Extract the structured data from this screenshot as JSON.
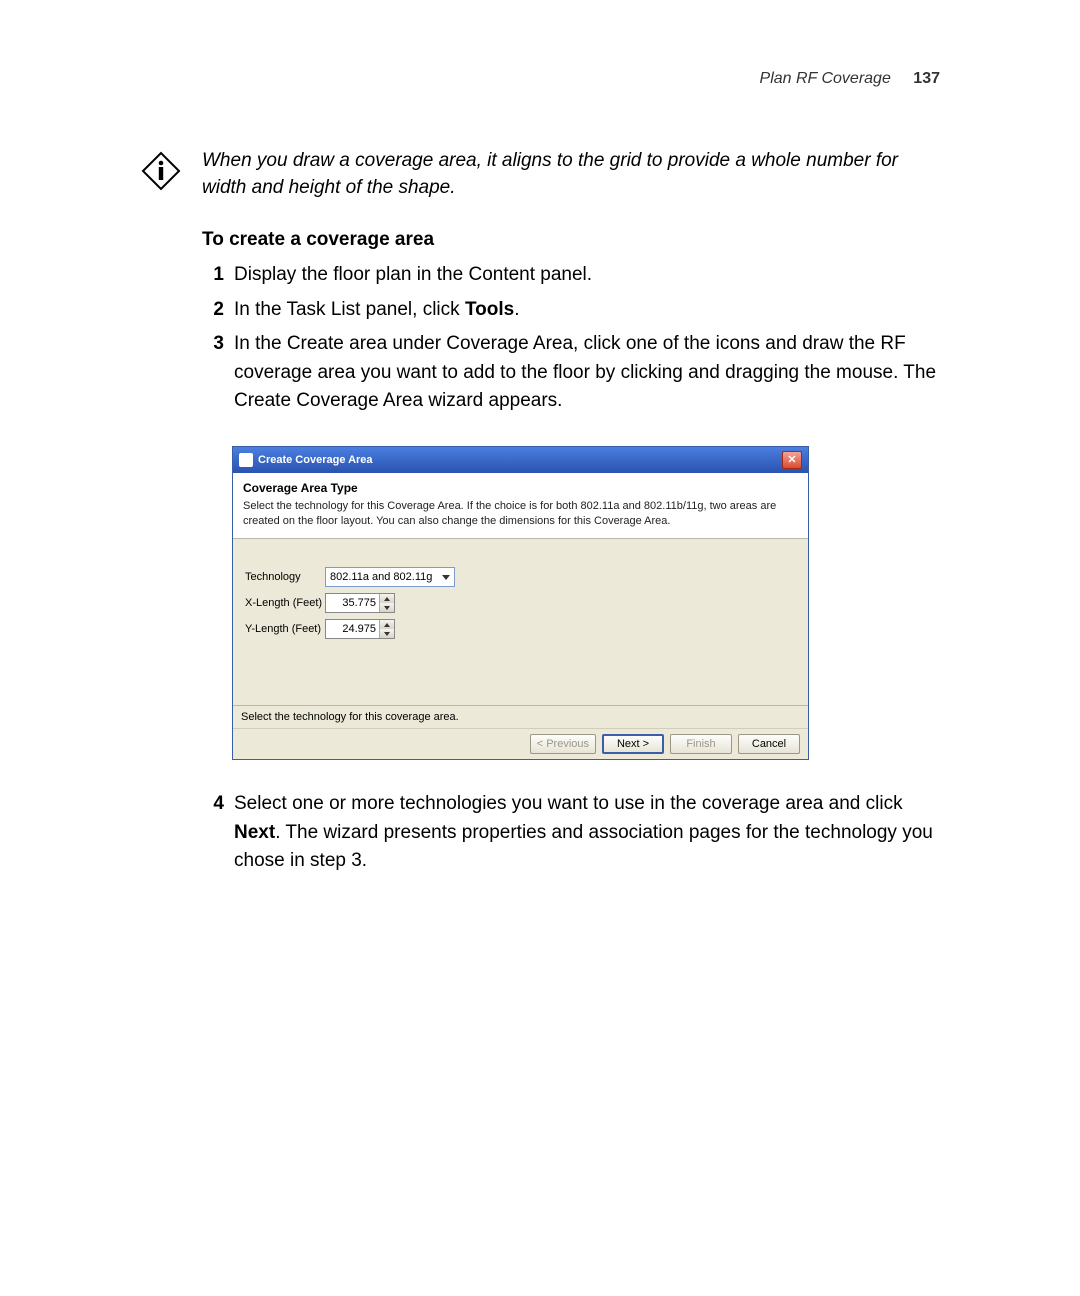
{
  "header": {
    "title": "Plan RF Coverage",
    "page_number": "137"
  },
  "info_note": "When you draw a coverage area, it aligns to the grid to provide a whole number for width and height of the shape.",
  "section_heading": "To create a coverage area",
  "steps": {
    "s1": {
      "num": "1",
      "text": "Display the floor plan in the Content panel."
    },
    "s2": {
      "num": "2",
      "pre": "In the Task List panel, click ",
      "bold": "Tools",
      "post": "."
    },
    "s3": {
      "num": "3",
      "text": "In the Create area under Coverage Area, click one of the icons and draw the RF coverage area you want to add to the floor by clicking and dragging the mouse. The Create Coverage Area wizard appears."
    },
    "s4": {
      "num": "4",
      "pre": "Select one or more technologies you want to use in the coverage area and click ",
      "bold": "Next",
      "post": ". The wizard presents properties and association pages for the technology you chose in step 3."
    }
  },
  "dialog": {
    "title": "Create Coverage Area",
    "heading": "Coverage Area Type",
    "description": "Select the technology for this Coverage Area. If the choice is for both 802.11a and 802.11b/11g, two areas are created on the floor layout. You can also change the dimensions for this Coverage Area.",
    "labels": {
      "technology": "Technology",
      "xlen": "X-Length (Feet)",
      "ylen": "Y-Length (Feet)"
    },
    "values": {
      "technology": "802.11a and 802.11g",
      "xlen": "35.775",
      "ylen": "24.975"
    },
    "status": "Select the technology for this coverage area.",
    "buttons": {
      "prev": "< Previous",
      "next": "Next >",
      "finish": "Finish",
      "cancel": "Cancel"
    }
  }
}
